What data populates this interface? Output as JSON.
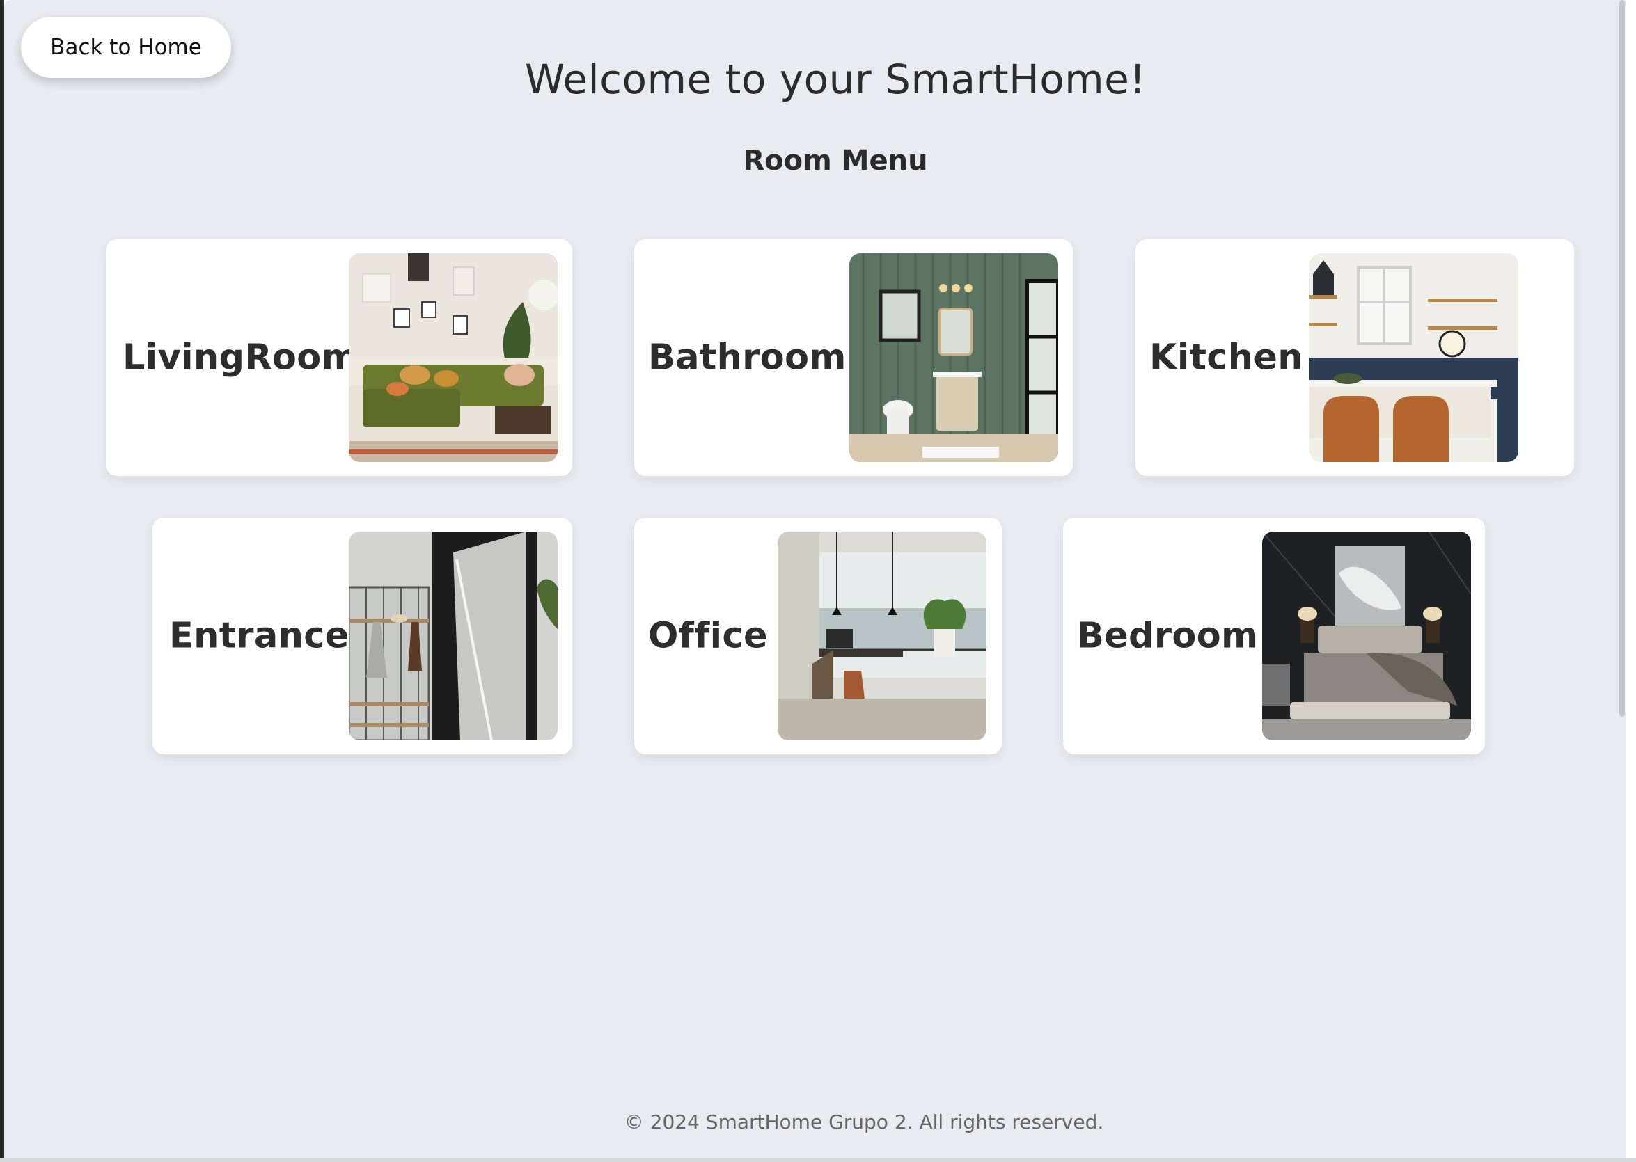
{
  "header": {
    "back_label": "Back to Home",
    "title": "Welcome to your SmartHome!",
    "subtitle": "Room Menu"
  },
  "rooms": [
    {
      "label": "LivingRoom",
      "image": "living-room-photo"
    },
    {
      "label": "Bathroom",
      "image": "bathroom-photo"
    },
    {
      "label": "Kitchen",
      "image": "kitchen-photo"
    },
    {
      "label": "Entrance",
      "image": "entrance-photo"
    },
    {
      "label": "Office",
      "image": "office-photo"
    },
    {
      "label": "Bedroom",
      "image": "bedroom-photo"
    }
  ],
  "footer": {
    "text": "© 2024 SmartHome Grupo 2. All rights reserved."
  },
  "colors": {
    "background": "#e8ebf0",
    "card": "#ffffff",
    "text": "#2d2d2d"
  }
}
